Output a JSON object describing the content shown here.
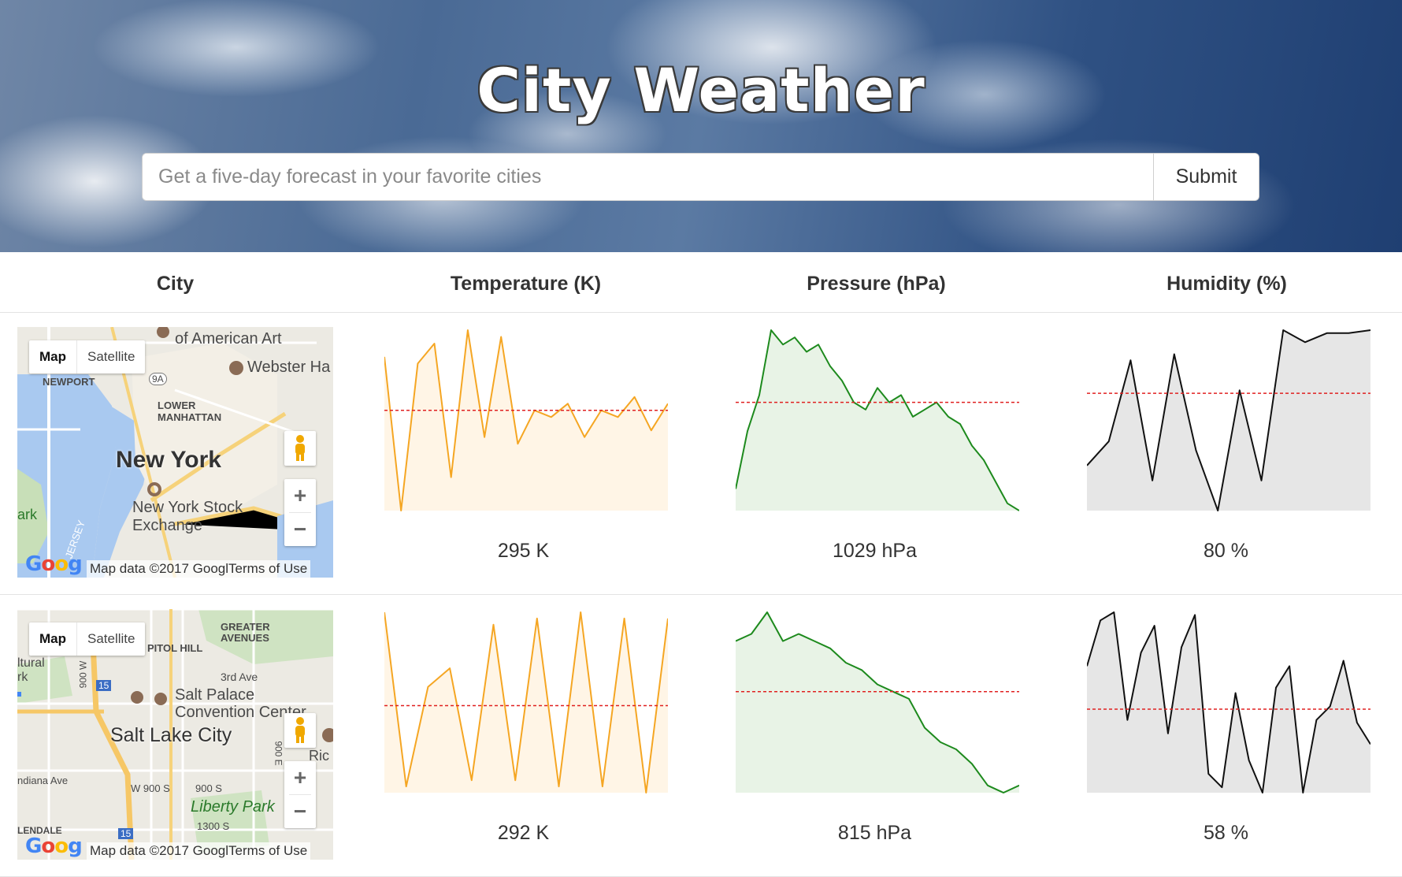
{
  "app": {
    "title": "City Weather",
    "search": {
      "placeholder": "Get a five-day forecast in your favorite cities",
      "value": "",
      "submit_label": "Submit"
    }
  },
  "table": {
    "headers": [
      "City",
      "Temperature (K)",
      "Pressure (hPa)",
      "Humidity (%)"
    ],
    "rows": [
      {
        "city": "New York",
        "map": {
          "map_label": "Map",
          "satellite_label": "Satellite",
          "labels": [
            "of American Art",
            "Webster Ha",
            "NEWPORT",
            "9A",
            "LOWER MANHATTAN",
            "New York",
            "New York Stock Exchange",
            "ark",
            "JERSEY"
          ],
          "attribution": "Map data ©2017 Googl",
          "terms": "Terms of Use",
          "logo": "Google"
        },
        "temperature": {
          "value": "295 K",
          "series": [
            304,
            281,
            303,
            306,
            286,
            308,
            292,
            307,
            291,
            296,
            295,
            297,
            292,
            296,
            295,
            298,
            293,
            297
          ],
          "avg": 296
        },
        "pressure": {
          "value": "1029 hPa",
          "series": [
            1007,
            1015,
            1020,
            1029,
            1027,
            1028,
            1026,
            1027,
            1024,
            1022,
            1019,
            1018,
            1021,
            1019,
            1020,
            1017,
            1018,
            1019,
            1017,
            1016,
            1013,
            1011,
            1008,
            1005,
            1004
          ],
          "avg": 1019
        },
        "humidity": {
          "value": "80 %",
          "series": [
            55,
            63,
            90,
            50,
            92,
            60,
            40,
            80,
            50,
            100,
            96,
            99,
            99,
            100
          ],
          "avg": 79
        }
      },
      {
        "city": "Salt Lake City",
        "map": {
          "map_label": "Map",
          "satellite_label": "Satellite",
          "labels": [
            "GREATER AVENUES",
            "PITOL HILL",
            "ltural",
            "rk",
            "3rd Ave",
            "15",
            "Salt Palace",
            "Convention Center",
            "Salt Lake City",
            "Ric",
            "900 E",
            "ndiana Ave",
            "W 900 S",
            "900 S",
            "Liberty Park",
            "1300 S",
            "LENDALE",
            "15",
            "900 W"
          ],
          "attribution": "Map data ©2017 Googl",
          "terms": "Terms of Use",
          "logo": "Google"
        },
        "temperature": {
          "value": "292 K",
          "series": [
            310,
            282,
            298,
            301,
            283,
            308,
            283,
            309,
            282,
            310,
            282,
            309,
            281,
            309
          ],
          "avg": 295
        },
        "pressure": {
          "value": "815 hPa",
          "series": [
            1020,
            1021,
            1024,
            1020,
            1021,
            1020,
            1019,
            1017,
            1016,
            1014,
            1013,
            1012,
            1008,
            1006,
            1005,
            1003,
            1000,
            999,
            1000
          ],
          "avg": 1013
        },
        "humidity": {
          "value": "58 %",
          "series": [
            80,
            97,
            100,
            60,
            85,
            95,
            55,
            87,
            99,
            40,
            35,
            70,
            45,
            33,
            72,
            80,
            33,
            60,
            65,
            82,
            59,
            51
          ],
          "avg": 64
        }
      }
    ]
  },
  "colors": {
    "temperature_line": "#f5a623",
    "temperature_fill": "#fff5e6",
    "pressure_line": "#1d8a1d",
    "pressure_fill": "#e8f3e6",
    "humidity_line": "#111111",
    "humidity_fill": "#e6e6e6",
    "average_line": "#e02020"
  }
}
